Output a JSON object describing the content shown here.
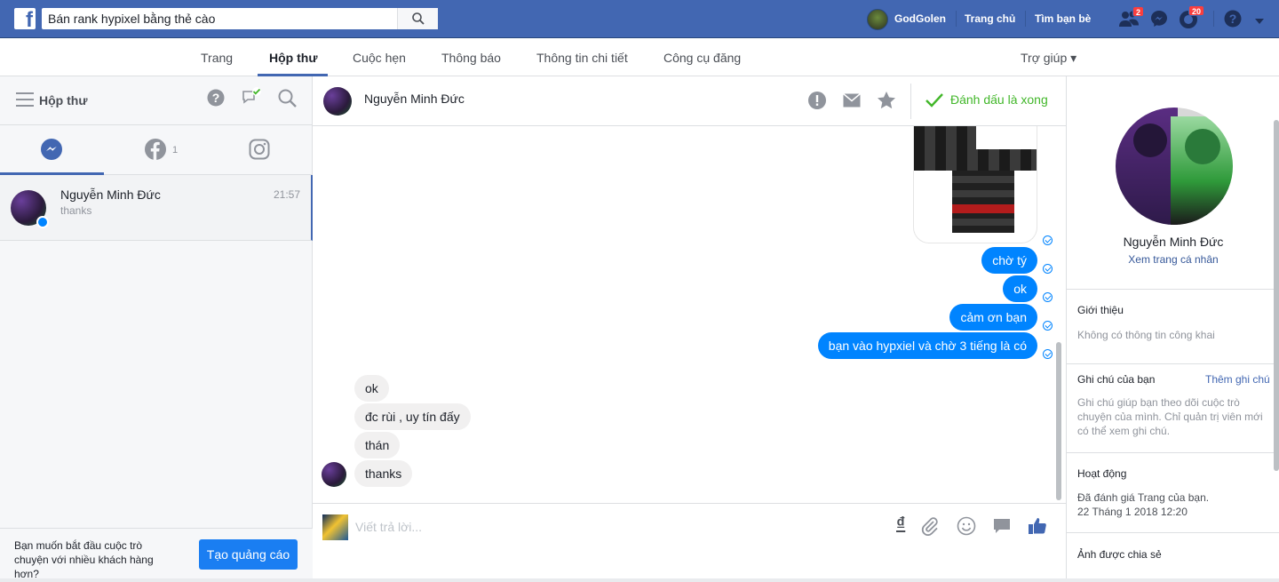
{
  "topbar": {
    "search_value": "Bán rank hypixel bằng thẻ cào",
    "user_name": "GodGolen",
    "home_link": "Trang chủ",
    "find_friends_link": "Tìm bạn bè",
    "friend_requests_badge": "2",
    "notifications_badge": "20",
    "brand_color": "#4267b2"
  },
  "page_tabs": {
    "items": [
      "Trang",
      "Hộp thư",
      "Cuộc hẹn",
      "Thông báo",
      "Thông tin chi tiết",
      "Công cụ đăng"
    ],
    "active": "Hộp thư",
    "help": "Trợ giúp ▾"
  },
  "inbox": {
    "title": "Hộp thư",
    "facebook_tab_count": "1",
    "thread": {
      "name": "Nguyễn Minh Đức",
      "snippet": "thanks",
      "time": "21:57"
    },
    "footer_text": "Bạn muốn bắt đầu cuộc trò chuyện với nhiều khách hàng hơn?",
    "ad_button": "Tạo quảng cáo"
  },
  "conversation": {
    "contact_name": "Nguyễn Minh Đức",
    "mark_done": "Đánh dấu là xong",
    "outgoing": [
      "chờ tý",
      "ok",
      "cảm ơn bạn",
      "bạn vào hypxiel và chờ 3 tiếng là có"
    ],
    "incoming": [
      "ok",
      "đc rùi , uy tín đấy",
      "thán",
      "thanks"
    ],
    "composer_placeholder": "Viết trả lời...",
    "currency_symbol": "₫",
    "accent_color": "#0084ff"
  },
  "profile": {
    "name": "Nguyễn Minh Đức",
    "view_profile": "Xem trang cá nhân",
    "about_title": "Giới thiệu",
    "about_text": "Không có thông tin công khai",
    "notes_title": "Ghi chú của bạn",
    "add_note": "Thêm ghi chú",
    "notes_text": "Ghi chú giúp bạn theo dõi cuộc trò chuyện của mình. Chỉ quản trị viên mới có thể xem ghi chú.",
    "activity_title": "Hoạt động",
    "activity_text": "Đã đánh giá Trang của bạn.",
    "activity_time": "22 Tháng 1 2018 12:20",
    "shared_photos_title": "Ảnh được chia sẻ"
  }
}
